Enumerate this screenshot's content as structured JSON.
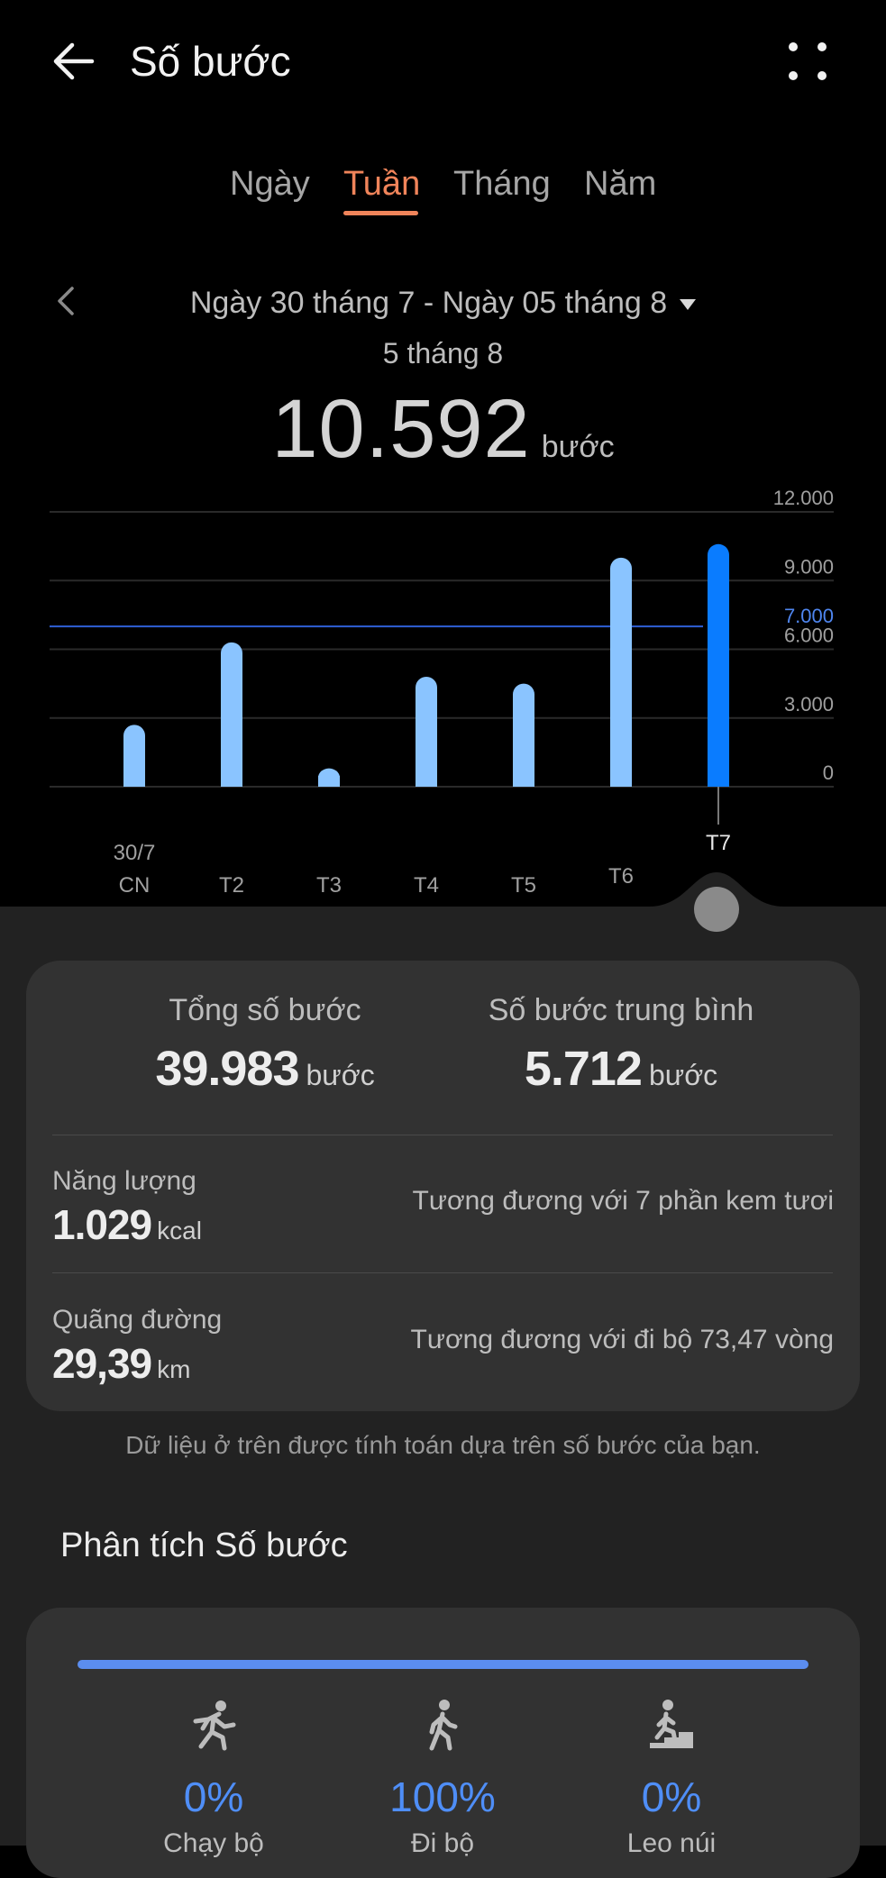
{
  "header": {
    "title": "Số bước"
  },
  "tabs": [
    {
      "label": "Ngày",
      "active": false
    },
    {
      "label": "Tuần",
      "active": true
    },
    {
      "label": "Tháng",
      "active": false
    },
    {
      "label": "Năm",
      "active": false
    }
  ],
  "range": {
    "label": "Ngày 30 tháng 7 - Ngày 05 tháng 8"
  },
  "selected": {
    "date": "5 tháng 8",
    "value": "10.592",
    "unit": "bước"
  },
  "colors": {
    "accent": "#f0845a",
    "bar": "#8ac4ff",
    "bar_selected": "#0a7cff",
    "goal_line": "#2f5fd6",
    "pct": "#4f8ef7"
  },
  "chart_data": {
    "type": "bar",
    "categories": [
      "CN",
      "T2",
      "T3",
      "T4",
      "T5",
      "T6",
      "T7"
    ],
    "first_date_label": "30/7",
    "values": [
      2700,
      6300,
      800,
      4800,
      4500,
      10000,
      10592
    ],
    "selected_index": 6,
    "y_ticks": [
      "12.000",
      "9.000",
      "6.000",
      "3.000",
      "0"
    ],
    "y_tick_values": [
      12000,
      9000,
      6000,
      3000,
      0
    ],
    "goal": {
      "value": 7000,
      "label": "7.000"
    },
    "ylim": [
      0,
      12000
    ],
    "grid": true
  },
  "summary": {
    "total_label": "Tổng số bước",
    "total_value": "39.983",
    "total_unit": "bước",
    "avg_label": "Số bước trung bình",
    "avg_value": "5.712",
    "avg_unit": "bước",
    "energy_label": "Năng lượng",
    "energy_value": "1.029",
    "energy_unit": "kcal",
    "energy_equiv": "Tương đương với 7 phần kem tươi",
    "distance_label": "Quãng đường",
    "distance_value": "29,39",
    "distance_unit": "km",
    "distance_equiv": "Tương đương với đi bộ 73,47 vòng"
  },
  "note": "Dữ liệu ở trên được tính toán dựa trên số bước của bạn.",
  "analysis": {
    "title": "Phân tích Số bước",
    "walk_fraction": 1.0,
    "activities": [
      {
        "icon": "running-icon",
        "pct": "0%",
        "label": "Chạy bộ"
      },
      {
        "icon": "walking-icon",
        "pct": "100%",
        "label": "Đi bộ"
      },
      {
        "icon": "climbing-icon",
        "pct": "0%",
        "label": "Leo núi"
      }
    ]
  }
}
